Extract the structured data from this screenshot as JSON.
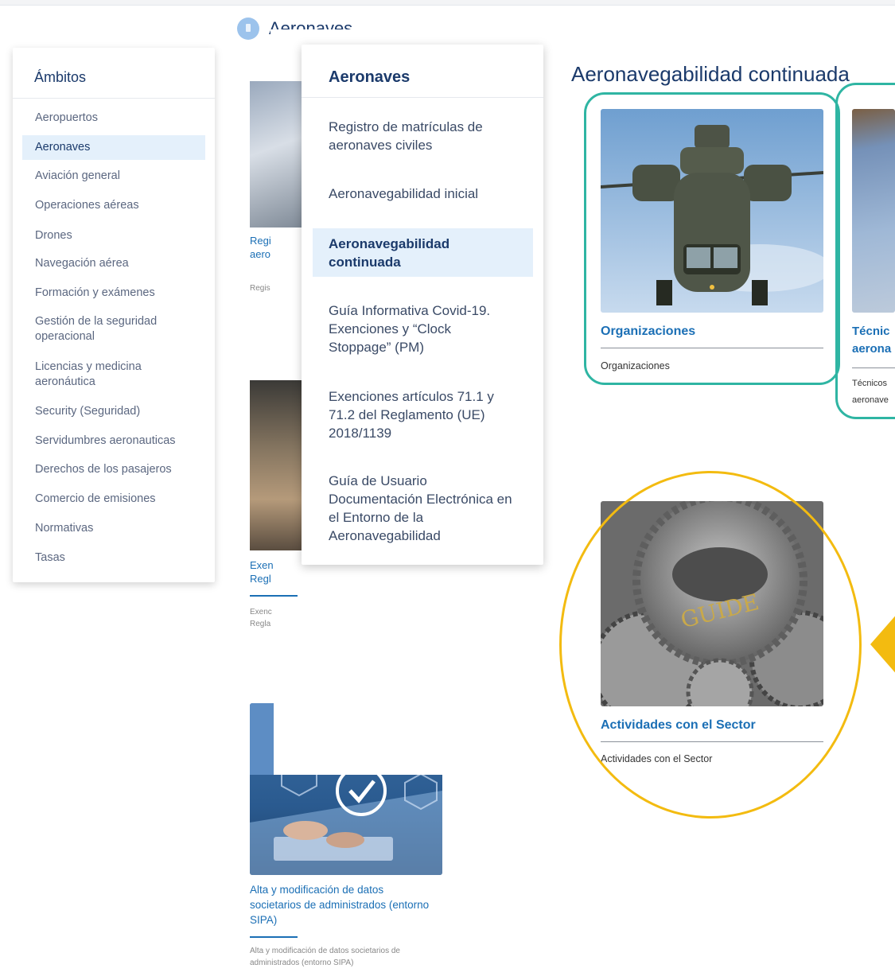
{
  "breadcrumb": {
    "label": "Aeronaves"
  },
  "ambitos": {
    "title": "Ámbitos",
    "items": [
      {
        "label": "Aeropuertos"
      },
      {
        "label": "Aeronaves"
      },
      {
        "label": "Aviación general"
      },
      {
        "label": "Operaciones aéreas"
      },
      {
        "label": "Drones"
      },
      {
        "label": "Navegación aérea"
      },
      {
        "label": "Formación y exámenes"
      },
      {
        "label": "Gestión de la seguridad operacional"
      },
      {
        "label": "Licencias y medicina aeronáutica"
      },
      {
        "label": "Security (Seguridad)"
      },
      {
        "label": "Servidumbres aeronauticas"
      },
      {
        "label": "Derechos de los pasajeros"
      },
      {
        "label": "Comercio de emisiones"
      },
      {
        "label": "Normativas"
      },
      {
        "label": "Tasas"
      }
    ],
    "active": "Aeronaves"
  },
  "aeronaves_menu": {
    "title": "Aeronaves",
    "items": [
      {
        "label": "Registro de matrículas de aeronaves civiles"
      },
      {
        "label": "Aeronavegabilidad inicial"
      },
      {
        "label": "Aeronavegabilidad continuada"
      },
      {
        "label": "Guía Informativa Covid-19. Exenciones y “Clock Stoppage” (PM)"
      },
      {
        "label": "Exenciones artículos 71.1 y 71.2 del Reglamento (UE) 2018/1139"
      },
      {
        "label": "Guía de Usuario Documentación Electrónica en el Entorno de la Aeronavegabilidad"
      }
    ],
    "active": "Aeronavegabilidad continuada"
  },
  "background_cards": {
    "card1": {
      "title_lines": [
        "Regi",
        "aero"
      ],
      "desc": "Regis"
    },
    "card2": {
      "title_lines": [
        "Exen",
        "Regl"
      ],
      "desc_lines": [
        "Exenc",
        "Regla"
      ]
    },
    "card3": {
      "title": "Alta y modificación de datos societarios de administrados (entorno SIPA)",
      "desc": "Alta y modificación de datos societarios de administrados (entorno SIPA)"
    }
  },
  "main": {
    "title": "Aeronavegabilidad continuada",
    "cards": [
      {
        "title": "Organizaciones",
        "desc": "Organizaciones"
      },
      {
        "title_lines": [
          "Técnic",
          "aerona"
        ],
        "desc_lines": [
          "Técnicos",
          "aeronave"
        ]
      },
      {
        "title": "Actividades con el Sector",
        "desc": "Actividades con el Sector",
        "image_text": "GUIDE"
      }
    ]
  },
  "colors": {
    "accent_blue": "#1b6fb5",
    "navy": "#1b3a6b",
    "highlight_teal": "#2fb5a3",
    "highlight_yellow": "#f3bb10",
    "active_bg": "#e4f0fb"
  }
}
